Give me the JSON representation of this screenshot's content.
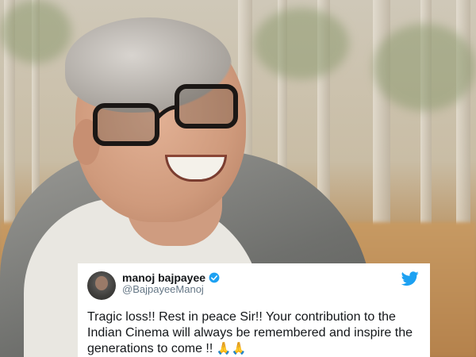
{
  "tweet": {
    "display_name": "manoj bajpayee",
    "handle": "@BajpayeeManoj",
    "text": "Tragic loss!! Rest in peace Sir!! Your contribution to the Indian Cinema will always be remembered and inspire the generations to come !!",
    "emoji": "🙏🙏"
  },
  "colors": {
    "twitter_blue": "#1da1f2",
    "verified_blue": "#1da1f2"
  },
  "icons": [
    "verified-badge-icon",
    "twitter-bird-icon"
  ]
}
